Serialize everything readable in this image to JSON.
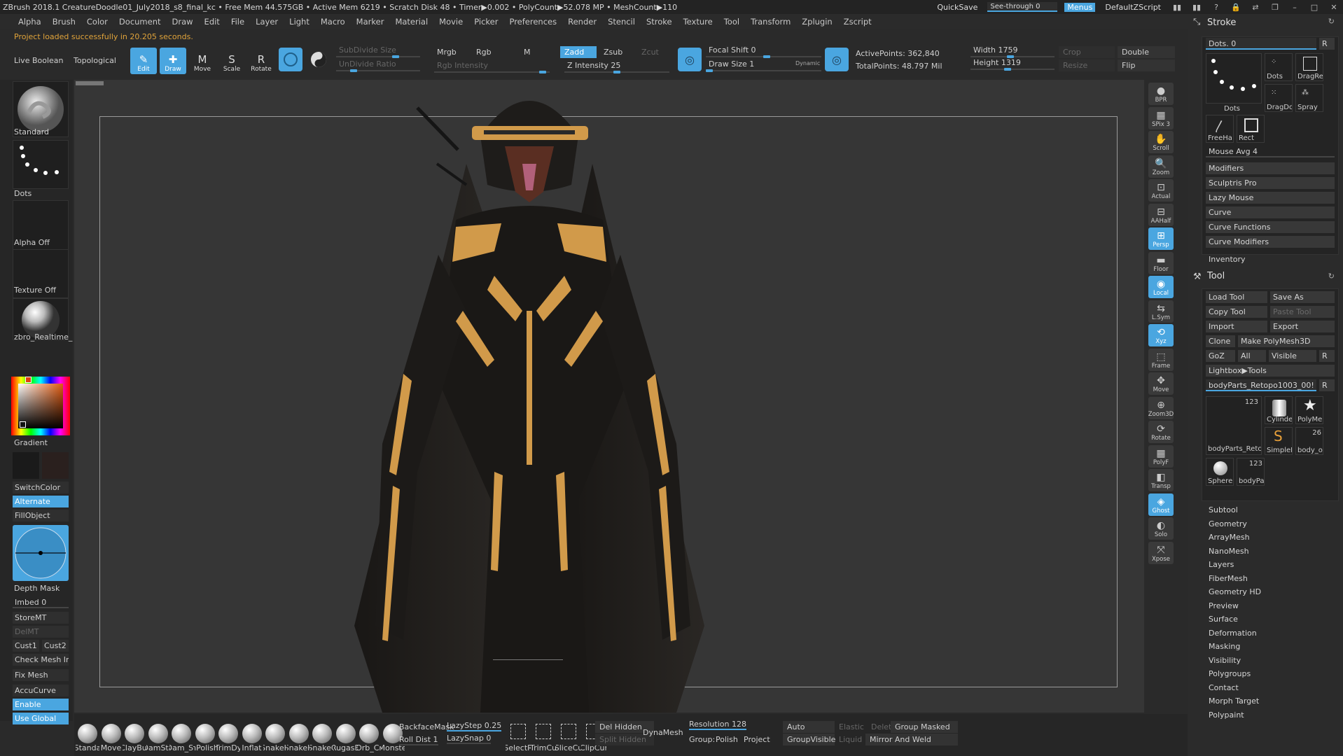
{
  "title_bar": {
    "text": "ZBrush 2018.1     CreatureDoodle01_July2018_s8_final_kc     • Free Mem 44.575GB • Active Mem 6219 • Scratch Disk 48 • Timer▶0.002 • PolyCount▶52.078 MP • MeshCount▶110",
    "quicksave": "QuickSave",
    "see_through": "See-through   0",
    "menus": "Menus",
    "script": "DefaultZScript"
  },
  "menus": [
    "Alpha",
    "Brush",
    "Color",
    "Document",
    "Draw",
    "Edit",
    "File",
    "Layer",
    "Light",
    "Macro",
    "Marker",
    "Material",
    "Movie",
    "Picker",
    "Preferences",
    "Render",
    "Stencil",
    "Stroke",
    "Texture",
    "Tool",
    "Transform",
    "Zplugin",
    "Zscript"
  ],
  "status": "Project loaded successfully in 20.205 seconds.",
  "top_shelf": {
    "live_boolean": "Live Boolean",
    "topological": "Topological",
    "modes": [
      "Edit",
      "Draw",
      "Move",
      "Scale",
      "Rotate"
    ],
    "subdivide_size": "SubDivide Size",
    "undivide_ratio": "UnDivide Ratio",
    "mrgb": "Mrgb",
    "rgb": "Rgb",
    "m": "M",
    "rgb_intensity": "Rgb Intensity",
    "zadd": "Zadd",
    "zsub": "Zsub",
    "zcut": "Zcut",
    "z_intensity": "Z Intensity 25",
    "focal_shift": "Focal Shift 0",
    "draw_size": "Draw Size 1",
    "dynamic": "Dynamic",
    "active_points": "ActivePoints: 362,840",
    "total_points": "TotalPoints: 48.797 Mil",
    "width": "Width 1759",
    "height": "Height 1319",
    "crop": "Crop",
    "resize": "Resize",
    "double": "Double",
    "flip": "Flip"
  },
  "left_shelf": {
    "brush": "Standard",
    "stroke": "Dots",
    "alpha": "Alpha Off",
    "texture": "Texture Off",
    "material": "zbro_Realtime_",
    "gradient": "Gradient",
    "switch_color": "SwitchColor",
    "alternate": "Alternate",
    "fill_object": "FillObject",
    "depth_mask": "Depth Mask",
    "imbed": "Imbed 0",
    "store_mt": "StoreMT",
    "del_mt": "DelMT",
    "cust1": "Cust1",
    "cust2": "Cust2",
    "check_mesh": "Check Mesh In",
    "fix_mesh": "Fix Mesh",
    "accu_curve": "AccuCurve",
    "enable": "Enable",
    "use_global": "Use Global"
  },
  "right_tools": [
    {
      "label": "BPR",
      "on": false
    },
    {
      "label": "SPix 3",
      "on": false
    },
    {
      "label": "Scroll",
      "on": false
    },
    {
      "label": "Zoom",
      "on": false
    },
    {
      "label": "Actual",
      "on": false
    },
    {
      "label": "AAHalf",
      "on": false
    },
    {
      "label": "Persp",
      "on": true
    },
    {
      "label": "Floor",
      "on": false
    },
    {
      "label": "Local",
      "on": true
    },
    {
      "label": "L.Sym",
      "on": false
    },
    {
      "label": "Xyz",
      "on": true
    },
    {
      "label": "Frame",
      "on": false
    },
    {
      "label": "Move",
      "on": false
    },
    {
      "label": "Zoom3D",
      "on": false
    },
    {
      "label": "Rotate",
      "on": false
    },
    {
      "label": "PolyF",
      "on": false
    },
    {
      "label": "Transp",
      "on": false
    },
    {
      "label": "Ghost",
      "on": true
    },
    {
      "label": "Solo",
      "on": false
    },
    {
      "label": "Xpose",
      "on": false
    }
  ],
  "stroke_panel": {
    "title": "Stroke",
    "dots_slider": "Dots. 0",
    "r": "R",
    "dots_label": "Dots",
    "items": [
      "Dots",
      "DragRe",
      "DragDo",
      "Spray",
      "FreeHa",
      "Rect"
    ],
    "mouse_avg": "Mouse Avg 4",
    "sub": [
      "Modifiers",
      "Sculptris Pro",
      "Lazy Mouse",
      "Curve",
      "Curve Functions",
      "Curve Modifiers"
    ],
    "inventory": "Inventory"
  },
  "tool_panel": {
    "title": "Tool",
    "load_tool": "Load Tool",
    "save_as": "Save As",
    "copy_tool": "Copy Tool",
    "paste_tool": "Paste Tool",
    "import": "Import",
    "export": "Export",
    "clone": "Clone",
    "make_polymesh": "Make PolyMesh3D",
    "goz": "GoZ",
    "all": "All",
    "visible": "Visible",
    "r": "R",
    "lightbox": "Lightbox▶Tools",
    "current_tool": "bodyParts_Retopo1003_00!",
    "thumb_count": "123",
    "thumbs": [
      "bodyParts_Retc",
      "Cylinde",
      "PolyMe",
      "SimpleE",
      "body_o",
      "Sphere",
      "bodyPa"
    ],
    "thumb_count2": "26",
    "thumb_count3": "123",
    "sub": [
      "Subtool",
      "Geometry",
      "ArrayMesh",
      "NanoMesh",
      "Layers",
      "FiberMesh",
      "Geometry HD",
      "Preview",
      "Surface",
      "Deformation",
      "Masking",
      "Visibility",
      "Polygroups",
      "Contact",
      "Morph Target",
      "Polypaint"
    ]
  },
  "bottom_shelf": {
    "brushes": [
      "Standa",
      "Move",
      "ClayBui",
      "DamSta",
      "Dam_St",
      "hPolish",
      "TrimDy",
      "Inflat",
      "SnakeH",
      "SnakeH",
      "SnakeC",
      "RugasB",
      "Orb_Cr",
      "Monste"
    ],
    "backface_mask": "BackfaceMask",
    "roll_dist": "Roll Dist 1",
    "lazy_step": "LazyStep 0.25",
    "lazy_snap": "LazySnap 0",
    "tools2": [
      "SelectR",
      "TrimCu",
      "SliceCu",
      "ClipCur"
    ],
    "del_hidden": "Del Hidden",
    "split_hidden": "Split Hidden",
    "dynamesh": "DynaMesh",
    "resolution": "Resolution 128",
    "group": "Group:",
    "polish": "Polish",
    "project": "Project",
    "auto_groups": "Auto Groups",
    "group_visible": "GroupVisible",
    "elastic": "Elastic",
    "liquid": "Liquid",
    "delete": "Delete",
    "group_masked": "Group Masked",
    "mirror_weld": "Mirror And Weld"
  }
}
